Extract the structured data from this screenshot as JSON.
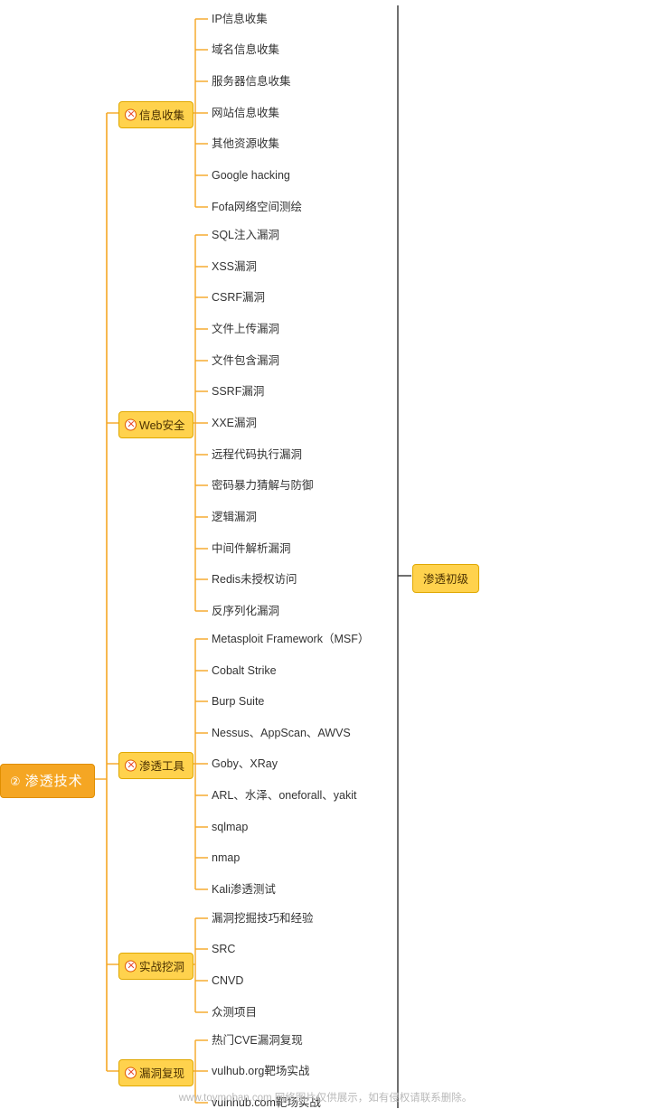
{
  "mindmap": {
    "root": {
      "number": "②",
      "label": "渗透技术"
    },
    "side_summary": {
      "label": "渗透初级"
    },
    "branches": [
      {
        "label": "信息收集",
        "leaves": [
          "IP信息收集",
          "域名信息收集",
          "服务器信息收集",
          "网站信息收集",
          "其他资源收集",
          "Google hacking",
          "Fofa网络空间测绘"
        ]
      },
      {
        "label": "Web安全",
        "leaves": [
          "SQL注入漏洞",
          "XSS漏洞",
          "CSRF漏洞",
          "文件上传漏洞",
          "文件包含漏洞",
          "SSRF漏洞",
          "XXE漏洞",
          "远程代码执行漏洞",
          "密码暴力猜解与防御",
          "逻辑漏洞",
          "中间件解析漏洞",
          "Redis未授权访问",
          "反序列化漏洞"
        ]
      },
      {
        "label": "渗透工具",
        "leaves": [
          "Metasploit Framework（MSF）",
          "Cobalt Strike",
          "Burp Suite",
          "Nessus、AppScan、AWVS",
          "Goby、XRay",
          "ARL、水泽、oneforall、yakit",
          "sqlmap",
          "nmap",
          "Kali渗透测试"
        ]
      },
      {
        "label": "实战挖洞",
        "leaves": [
          "漏洞挖掘技巧和经验",
          "SRC",
          "CNVD",
          "众测项目"
        ]
      },
      {
        "label": "漏洞复现",
        "leaves": [
          "热门CVE漏洞复现",
          "vulhub.org靶场实战",
          "vulnhub.com靶场实战"
        ]
      }
    ]
  },
  "watermark": {
    "text": "www.toymoban.com 网络图片仅供展示，如有侵权请联系删除。"
  },
  "colors": {
    "root_bg": "#f5a623",
    "branch_bg": "#ffd24d",
    "line": "#f5a623",
    "trunk": "#333333",
    "text": "#333333"
  }
}
